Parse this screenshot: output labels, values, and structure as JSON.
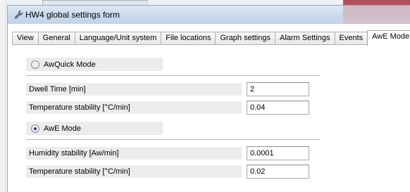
{
  "window": {
    "title": "HW4 global settings form"
  },
  "tabs": [
    {
      "label": "View"
    },
    {
      "label": "General"
    },
    {
      "label": "Language/Unit system"
    },
    {
      "label": "File locations"
    },
    {
      "label": "Graph settings"
    },
    {
      "label": "Alarm Settings"
    },
    {
      "label": "Events"
    },
    {
      "label": "AwE Mode",
      "active": true
    }
  ],
  "awquick": {
    "label": "AwQuick Mode",
    "selected": false,
    "fields": [
      {
        "label": "Dwell Time [min]",
        "value": "2"
      },
      {
        "label": "Temperature stability [°C/min]",
        "value": "0.04"
      }
    ]
  },
  "awe": {
    "label": "AwE Mode",
    "selected": true,
    "fields": [
      {
        "label": "Humidity stability [Aw/min]",
        "value": "0.0001"
      },
      {
        "label": "Temperature stability [°C/min]",
        "value": "0.02"
      }
    ]
  },
  "colors": {
    "titlebar": "#c9d9ec",
    "label_bg": "#ececec",
    "radio_dot": "#1b3f7a"
  }
}
